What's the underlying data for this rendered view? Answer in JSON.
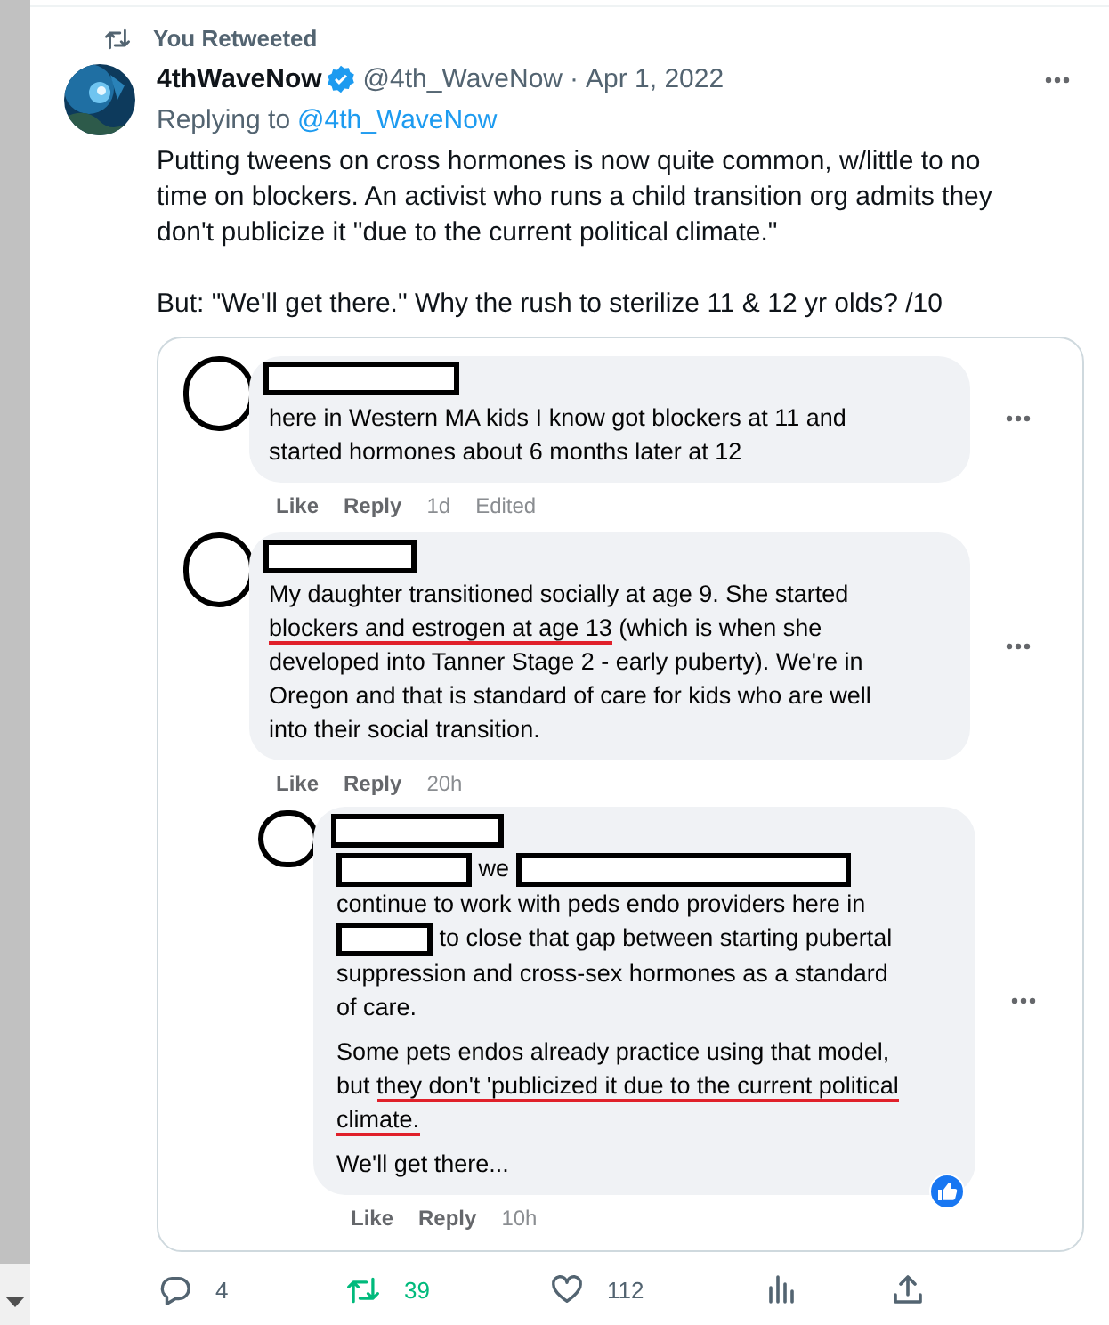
{
  "retweet_banner": {
    "text": "You Retweeted"
  },
  "tweet": {
    "author": {
      "name": "4thWaveNow",
      "verified": true,
      "handle": "@4th_WaveNow",
      "separator": "·",
      "date": "Apr 1, 2022"
    },
    "replying": {
      "label": "Replying to",
      "handle": "@4th_WaveNow"
    },
    "paragraphs": [
      "Putting tweens on cross hormones is now quite common, w/little to no time on blockers. An activist who runs a child transition org admits they don't publicize it \"due to the current political climate.\"",
      "But: \"We'll get there.\" Why the rush to sterilize 11 & 12 yr olds? /10"
    ],
    "screenshot": {
      "comments": [
        {
          "kind": "comment",
          "paragraphs": [
            [
              {
                "kind": "text",
                "text": "here in Western MA kids I know got blockers at 11 and started hormones about 6 months later at 12",
                "underlined": false
              }
            ]
          ],
          "meta": [
            "Like",
            "Reply",
            "1d",
            "Edited"
          ],
          "reacted": false
        },
        {
          "kind": "comment",
          "paragraphs": [
            [
              {
                "kind": "text",
                "text": "My daughter transitioned socially at age 9. She started ",
                "underlined": false
              },
              {
                "kind": "text",
                "text": "blockers and estrogen at age 13",
                "underlined": true
              },
              {
                "kind": "text",
                "text": " (which is when she developed into Tanner Stage 2 - early puberty). We're in Oregon and that is standard of care for kids who are well into their social transition.",
                "underlined": false
              }
            ]
          ],
          "meta": [
            "Like",
            "Reply",
            "20h"
          ],
          "reacted": false,
          "children": [
            {
              "kind": "comment",
              "paragraphs": [
                [
                  {
                    "kind": "redaction"
                  },
                  {
                    "kind": "text",
                    "text": "we",
                    "underlined": false
                  },
                  {
                    "kind": "redaction"
                  },
                  {
                    "kind": "break"
                  },
                  {
                    "kind": "text",
                    "text": "continue to work with peds endo providers here in",
                    "underlined": false
                  },
                  {
                    "kind": "break"
                  },
                  {
                    "kind": "redaction"
                  },
                  {
                    "kind": "text",
                    "text": "to close that gap between starting pubertal",
                    "underlined": false
                  },
                  {
                    "kind": "break"
                  },
                  {
                    "kind": "text",
                    "text": "suppression and cross-sex hormones as a standard",
                    "underlined": false
                  },
                  {
                    "kind": "break"
                  },
                  {
                    "kind": "text",
                    "text": "of care.",
                    "underlined": false
                  }
                ],
                [
                  {
                    "kind": "text",
                    "text": "Some pets endos already practice using that model, but ",
                    "underlined": false
                  },
                  {
                    "kind": "text",
                    "text": "they don't 'publicized it due to the current political climate.",
                    "underlined": true
                  }
                ],
                [
                  {
                    "kind": "text",
                    "text": "We'll get there...",
                    "underlined": false
                  }
                ]
              ],
              "meta": [
                "Like",
                "Reply",
                "10h"
              ],
              "reacted": true
            }
          ]
        }
      ]
    },
    "actions": [
      {
        "kind": "reply",
        "count": "4",
        "active": false
      },
      {
        "kind": "retweet",
        "count": "39",
        "active": true
      },
      {
        "kind": "like",
        "count": "112",
        "active": false
      },
      {
        "kind": "views"
      },
      {
        "kind": "share"
      }
    ]
  }
}
